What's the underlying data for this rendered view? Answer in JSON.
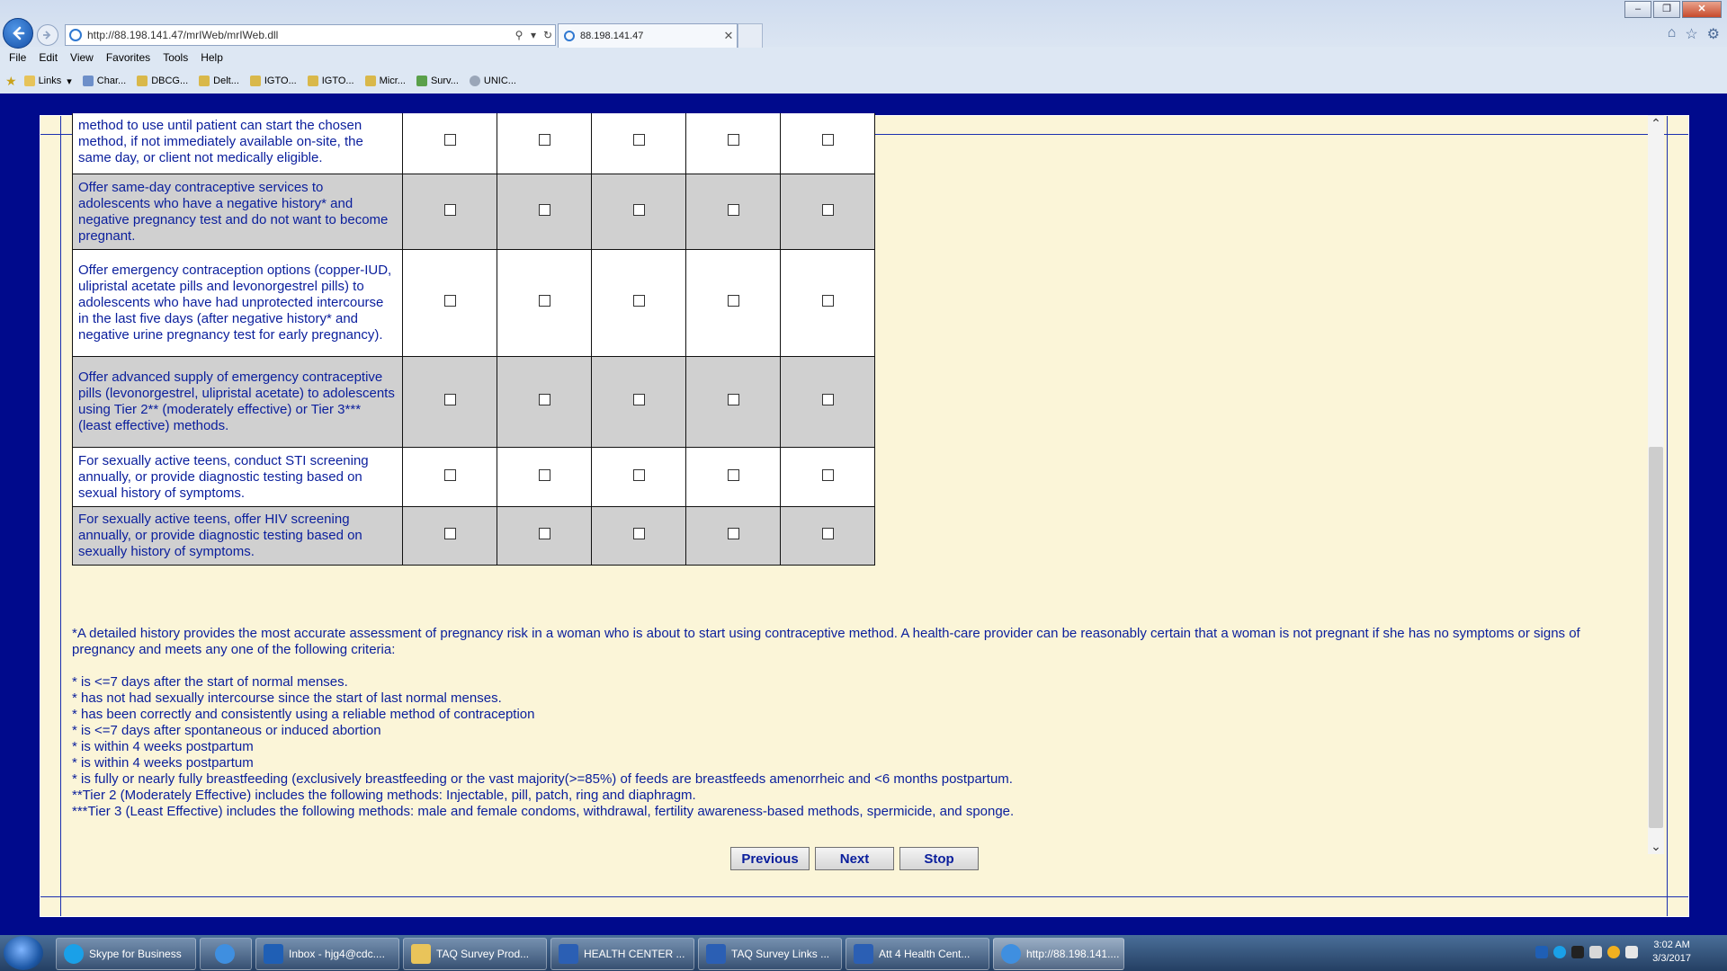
{
  "browser": {
    "address_url": "http://88.198.141.47/mrIWeb/mrIWeb.dll",
    "tab_title": "88.198.141.47",
    "menu": [
      "File",
      "Edit",
      "View",
      "Favorites",
      "Tools",
      "Help"
    ],
    "favorites": [
      "Links",
      "Char...",
      "DBCG...",
      "Delt...",
      "IGTO...",
      "IGTO...",
      "Micr...",
      "Surv...",
      "UNIC..."
    ]
  },
  "survey": {
    "rows": [
      {
        "text": "method to use until patient can start the chosen method, if not immediately available on-site, the same day, or client not medically eligible."
      },
      {
        "text": "Offer same-day contraceptive services to adolescents who have a negative history* and negative pregnancy test and do not want to become pregnant."
      },
      {
        "text": "Offer emergency contraception options (copper-IUD, ulipristal acetate pills and levonorgestrel pills) to adolescents who have had unprotected intercourse in the last five days (after negative history* and negative urine pregnancy test for early pregnancy)."
      },
      {
        "text": "Offer advanced supply of emergency contraceptive pills (levonorgestrel, ulipristal acetate) to adolescents using Tier 2** (moderately effective) or Tier 3*** (least effective) methods."
      },
      {
        "text": "For sexually active teens, conduct STI screening annually, or provide diagnostic testing based on sexual history of symptoms."
      },
      {
        "text": "For sexually active teens, offer HIV screening annually, or provide diagnostic testing based on sexually history of symptoms."
      }
    ],
    "notes": {
      "intro": "*A detailed history provides the most accurate assessment of pregnancy risk in a woman who is about to start using contraceptive method. A health-care provider can be reasonably certain that a woman is not pregnant if she has no symptoms or signs of pregnancy and meets any one of the following criteria:",
      "criteria": [
        "* is <=7 days after the start of normal menses.",
        "* has not had sexually intercourse since the start of last normal menses.",
        "* has been correctly and consistently using a reliable method of contraception",
        "* is <=7 days after spontaneous or induced abortion",
        "* is within 4 weeks postpartum",
        "* is within 4 weeks postpartum",
        "* is fully or nearly fully breastfeeding (exclusively breastfeeding or the vast majority(>=85%) of feeds are breastfeeds amenorrheic and <6 months postpartum."
      ],
      "tier2": "**Tier 2 (Moderately Effective) includes the following methods: Injectable, pill, patch, ring and diaphragm.",
      "tier3": "***Tier 3 (Least Effective) includes the following methods: male and female condoms, withdrawal, fertility awareness-based methods, spermicide, and sponge."
    },
    "buttons": {
      "previous": "Previous",
      "next": "Next",
      "stop": "Stop"
    }
  },
  "taskbar": {
    "items": [
      "Skype for Business",
      "Inbox - hjg4@cdc....",
      "TAQ Survey Prod...",
      "HEALTH CENTER ...",
      "TAQ Survey Links ...",
      "Att 4 Health Cent...",
      "http://88.198.141...."
    ],
    "time": "3:02 AM",
    "date": "3/3/2017"
  }
}
